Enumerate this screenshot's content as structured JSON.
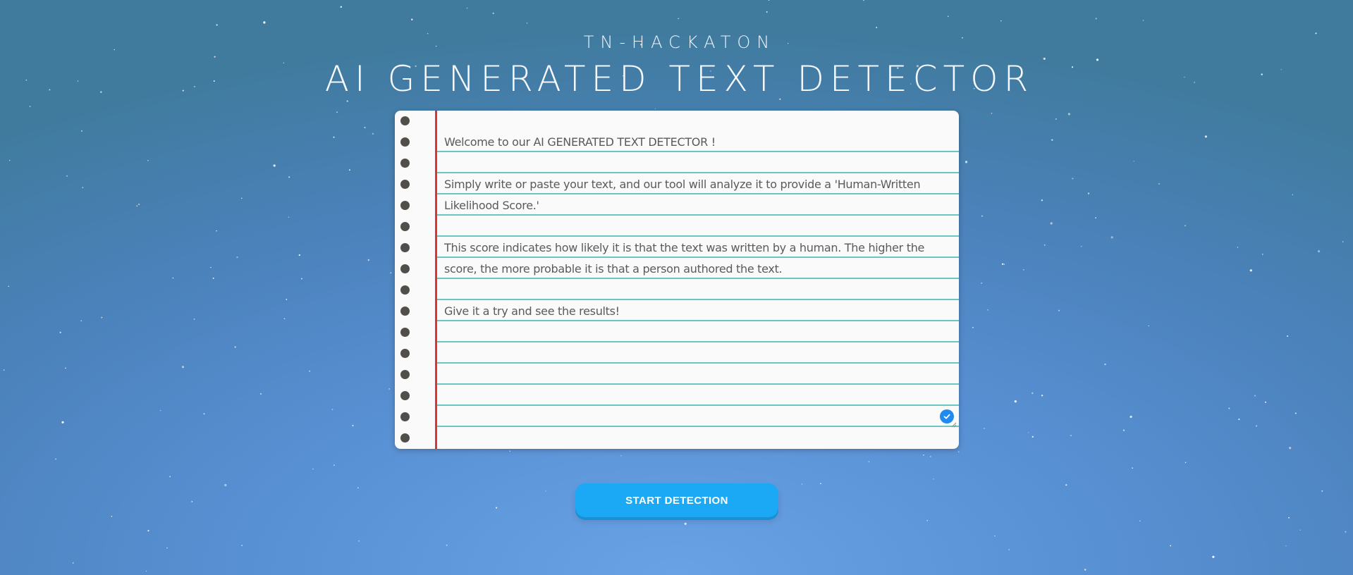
{
  "header": {
    "subtitle": "TN-HACKATON",
    "title": "AI GENERATED TEXT DETECTOR"
  },
  "editor": {
    "paragraphs": [
      "Welcome to our AI GENERATED TEXT DETECTOR !",
      "",
      "Simply write or paste your text, and our tool will analyze it to provide a 'Human-Written Likelihood Score.'",
      "",
      "This score indicates how likely it is that the text was written by a human. The higher the score, the more probable it is that a person authored the text.",
      "",
      "Give it a try and see the results!"
    ],
    "status_icon": "checkmark-circle-icon"
  },
  "actions": {
    "start_label": "START DETECTION"
  },
  "colors": {
    "paper": "#fafafa",
    "margin_line": "#d9343a",
    "rule_line": "#6cc4c4",
    "button": "#1ba9f5",
    "hole": "#524f4b"
  }
}
